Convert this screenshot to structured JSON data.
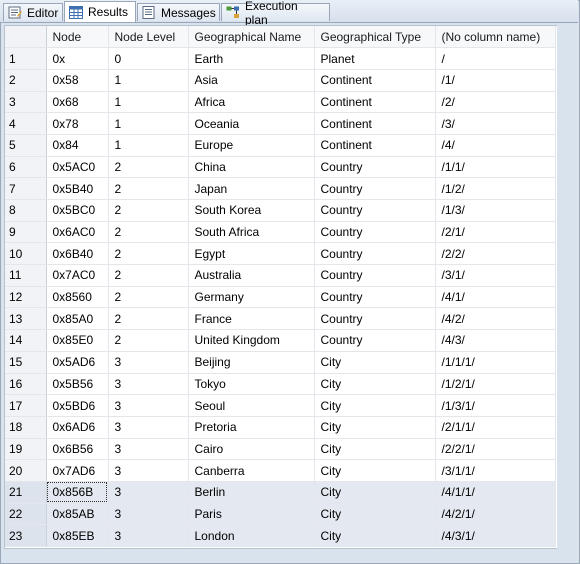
{
  "tabs": [
    {
      "label": "Editor",
      "icon": "editor-icon",
      "active": false
    },
    {
      "label": "Results",
      "icon": "grid-icon",
      "active": true
    },
    {
      "label": "Messages",
      "icon": "messages-icon",
      "active": false
    },
    {
      "label": "Execution plan",
      "icon": "execution-plan-icon",
      "active": false
    }
  ],
  "grid": {
    "columns": [
      "Node",
      "Node Level",
      "Geographical Name",
      "Geographical Type",
      "(No column name)"
    ],
    "rows": [
      [
        "1",
        "0x",
        "0",
        "Earth",
        "Planet",
        "/"
      ],
      [
        "2",
        "0x58",
        "1",
        "Asia",
        "Continent",
        "/1/"
      ],
      [
        "3",
        "0x68",
        "1",
        "Africa",
        "Continent",
        "/2/"
      ],
      [
        "4",
        "0x78",
        "1",
        "Oceania",
        "Continent",
        "/3/"
      ],
      [
        "5",
        "0x84",
        "1",
        "Europe",
        "Continent",
        "/4/"
      ],
      [
        "6",
        "0x5AC0",
        "2",
        "China",
        "Country",
        "/1/1/"
      ],
      [
        "7",
        "0x5B40",
        "2",
        "Japan",
        "Country",
        "/1/2/"
      ],
      [
        "8",
        "0x5BC0",
        "2",
        "South Korea",
        "Country",
        "/1/3/"
      ],
      [
        "9",
        "0x6AC0",
        "2",
        "South Africa",
        "Country",
        "/2/1/"
      ],
      [
        "10",
        "0x6B40",
        "2",
        "Egypt",
        "Country",
        "/2/2/"
      ],
      [
        "11",
        "0x7AC0",
        "2",
        "Australia",
        "Country",
        "/3/1/"
      ],
      [
        "12",
        "0x8560",
        "2",
        "Germany",
        "Country",
        "/4/1/"
      ],
      [
        "13",
        "0x85A0",
        "2",
        "France",
        "Country",
        "/4/2/"
      ],
      [
        "14",
        "0x85E0",
        "2",
        "United Kingdom",
        "Country",
        "/4/3/"
      ],
      [
        "15",
        "0x5AD6",
        "3",
        "Beijing",
        "City",
        "/1/1/1/"
      ],
      [
        "16",
        "0x5B56",
        "3",
        "Tokyo",
        "City",
        "/1/2/1/"
      ],
      [
        "17",
        "0x5BD6",
        "3",
        "Seoul",
        "City",
        "/1/3/1/"
      ],
      [
        "18",
        "0x6AD6",
        "3",
        "Pretoria",
        "City",
        "/2/1/1/"
      ],
      [
        "19",
        "0x6B56",
        "3",
        "Cairo",
        "City",
        "/2/2/1/"
      ],
      [
        "20",
        "0x7AD6",
        "3",
        "Canberra",
        "City",
        "/3/1/1/"
      ],
      [
        "21",
        "0x856B",
        "3",
        "Berlin",
        "City",
        "/4/1/1/"
      ],
      [
        "22",
        "0x85AB",
        "3",
        "Paris",
        "City",
        "/4/2/1/"
      ],
      [
        "23",
        "0x85EB",
        "3",
        "London",
        "City",
        "/4/3/1/"
      ]
    ],
    "selected_rows": [
      21,
      22,
      23
    ]
  },
  "colors": {
    "selection": "#e4e9f1",
    "header": "#f7f8fa",
    "frame": "#d9e3ee"
  }
}
